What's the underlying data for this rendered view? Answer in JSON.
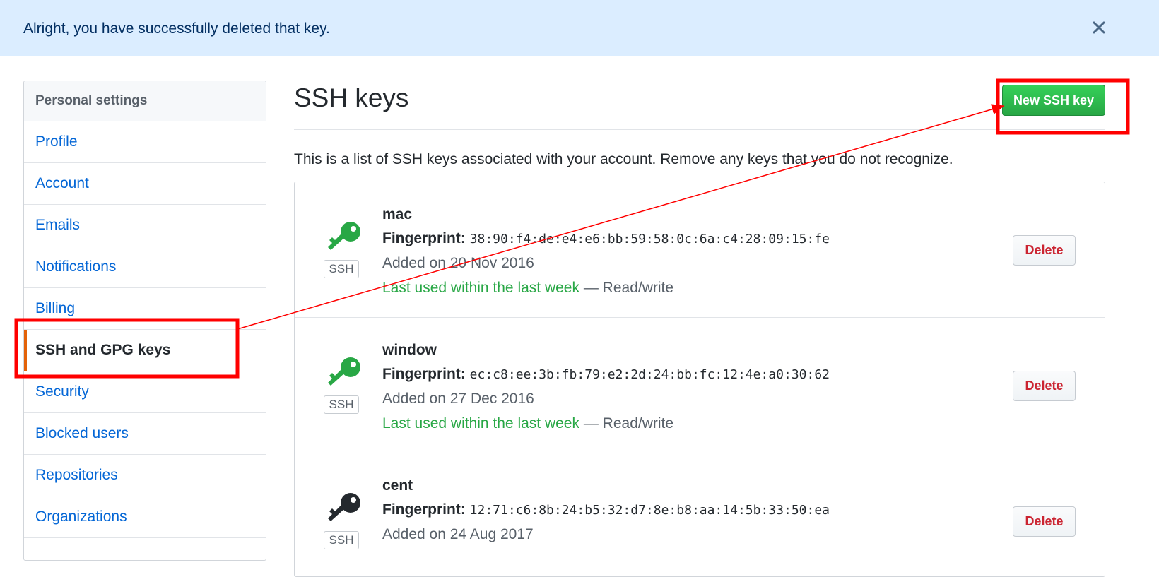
{
  "flash": {
    "message": "Alright, you have successfully deleted that key."
  },
  "sidebar": {
    "header": "Personal settings",
    "items": [
      {
        "label": "Profile"
      },
      {
        "label": "Account"
      },
      {
        "label": "Emails"
      },
      {
        "label": "Notifications"
      },
      {
        "label": "Billing"
      },
      {
        "label": "SSH and GPG keys",
        "selected": true
      },
      {
        "label": "Security"
      },
      {
        "label": "Blocked users"
      },
      {
        "label": "Repositories"
      },
      {
        "label": "Organizations"
      }
    ]
  },
  "main": {
    "title": "SSH keys",
    "new_key_label": "New SSH key",
    "description": "This is a list of SSH keys associated with your account. Remove any keys that you do not recognize.",
    "fingerprint_label": "Fingerprint:",
    "badge_label": "SSH",
    "delete_label": "Delete",
    "keys": [
      {
        "title": "mac",
        "fingerprint": "38:90:f4:de:e4:e6:bb:59:58:0c:6a:c4:28:09:15:fe",
        "added": "Added on 20 Nov 2016",
        "last_used": "Last used within the last week",
        "access": " — Read/write",
        "icon_color": "#28a745"
      },
      {
        "title": "window",
        "fingerprint": "ec:c8:ee:3b:fb:79:e2:2d:24:bb:fc:12:4e:a0:30:62",
        "added": "Added on 27 Dec 2016",
        "last_used": "Last used within the last week",
        "access": " — Read/write",
        "icon_color": "#28a745"
      },
      {
        "title": "cent",
        "fingerprint": "12:71:c6:8b:24:b5:32:d7:8e:b8:aa:14:5b:33:50:ea",
        "added": "Added on 24 Aug 2017",
        "last_used": "",
        "access": "",
        "icon_color": "#24292e"
      }
    ]
  },
  "colors": {
    "annotation": "#ff0000",
    "selected_accent": "#e36209"
  }
}
